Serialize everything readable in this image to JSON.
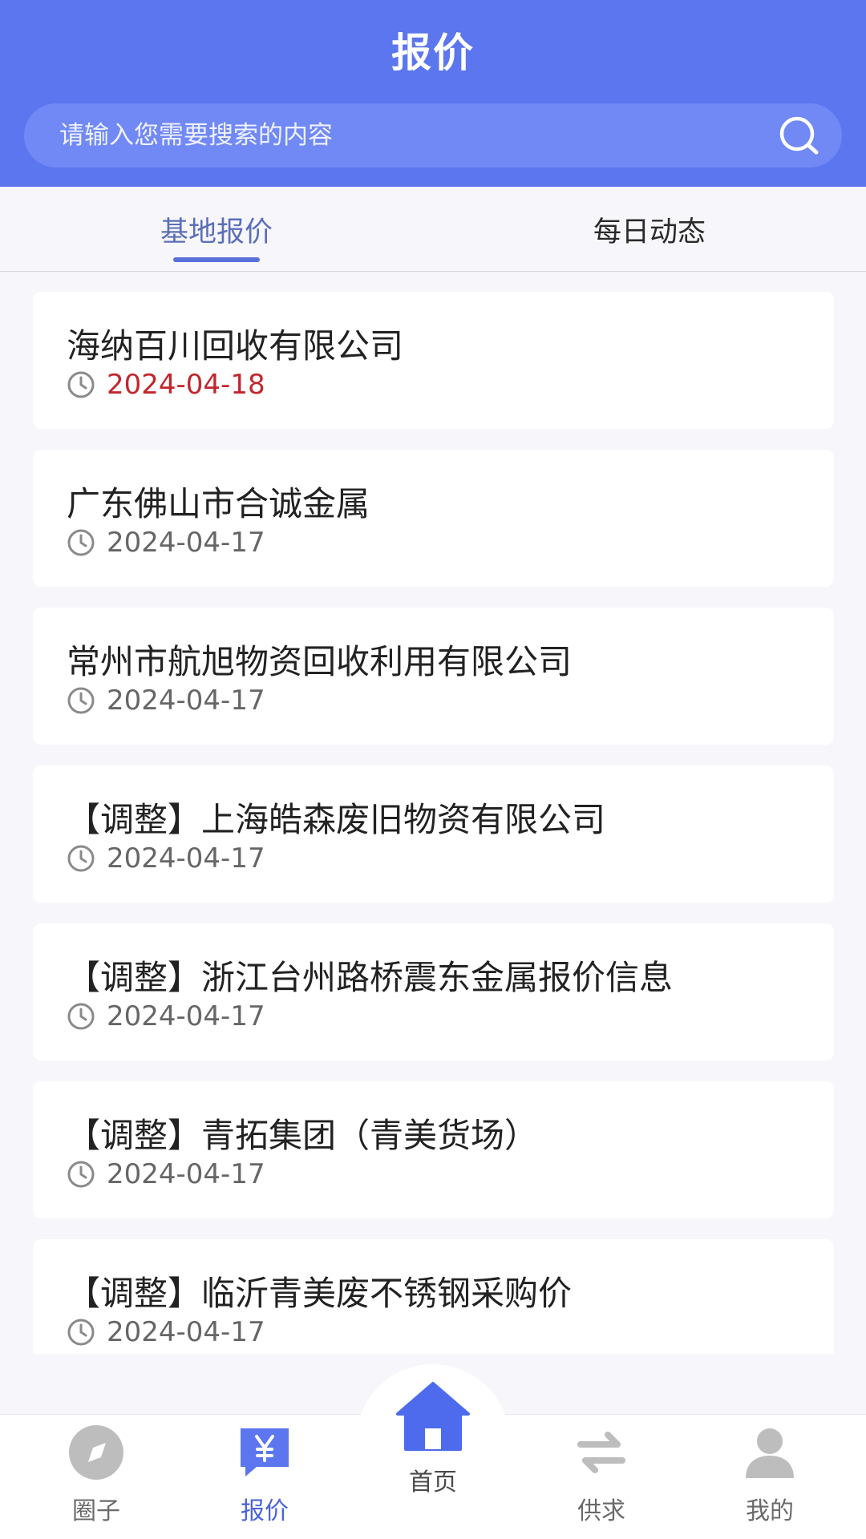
{
  "header": {
    "title": "报价",
    "search_placeholder": "请输入您需要搜索的内容"
  },
  "tabs": [
    {
      "label": "基地报价",
      "active": true
    },
    {
      "label": "每日动态",
      "active": false
    }
  ],
  "quotes": [
    {
      "title": "海纳百川回收有限公司",
      "date": "2024-04-18",
      "highlight": true
    },
    {
      "title": "广东佛山市合诚金属",
      "date": "2024-04-17",
      "highlight": false
    },
    {
      "title": "常州市航旭物资回收利用有限公司",
      "date": "2024-04-17",
      "highlight": false
    },
    {
      "title": "【调整】上海皓森废旧物资有限公司",
      "date": "2024-04-17",
      "highlight": false
    },
    {
      "title": "【调整】浙江台州路桥震东金属报价信息",
      "date": "2024-04-17",
      "highlight": false
    },
    {
      "title": "【调整】青拓集团（青美货场）",
      "date": "2024-04-17",
      "highlight": false
    },
    {
      "title": "【调整】临沂青美废不锈钢采购价",
      "date": "2024-04-17",
      "highlight": false
    }
  ],
  "bottom_nav": {
    "circle": {
      "label": "圈子",
      "icon": "compass-icon"
    },
    "quote": {
      "label": "报价",
      "icon": "yen-chat-icon",
      "active": true
    },
    "home": {
      "label": "首页",
      "icon": "home-icon"
    },
    "supply": {
      "label": "供求",
      "icon": "swap-icon"
    },
    "mine": {
      "label": "我的",
      "icon": "user-icon"
    }
  },
  "colors": {
    "brand": "#5b76ee",
    "active_text": "#4a63d8",
    "highlight_date": "#c1272d"
  }
}
